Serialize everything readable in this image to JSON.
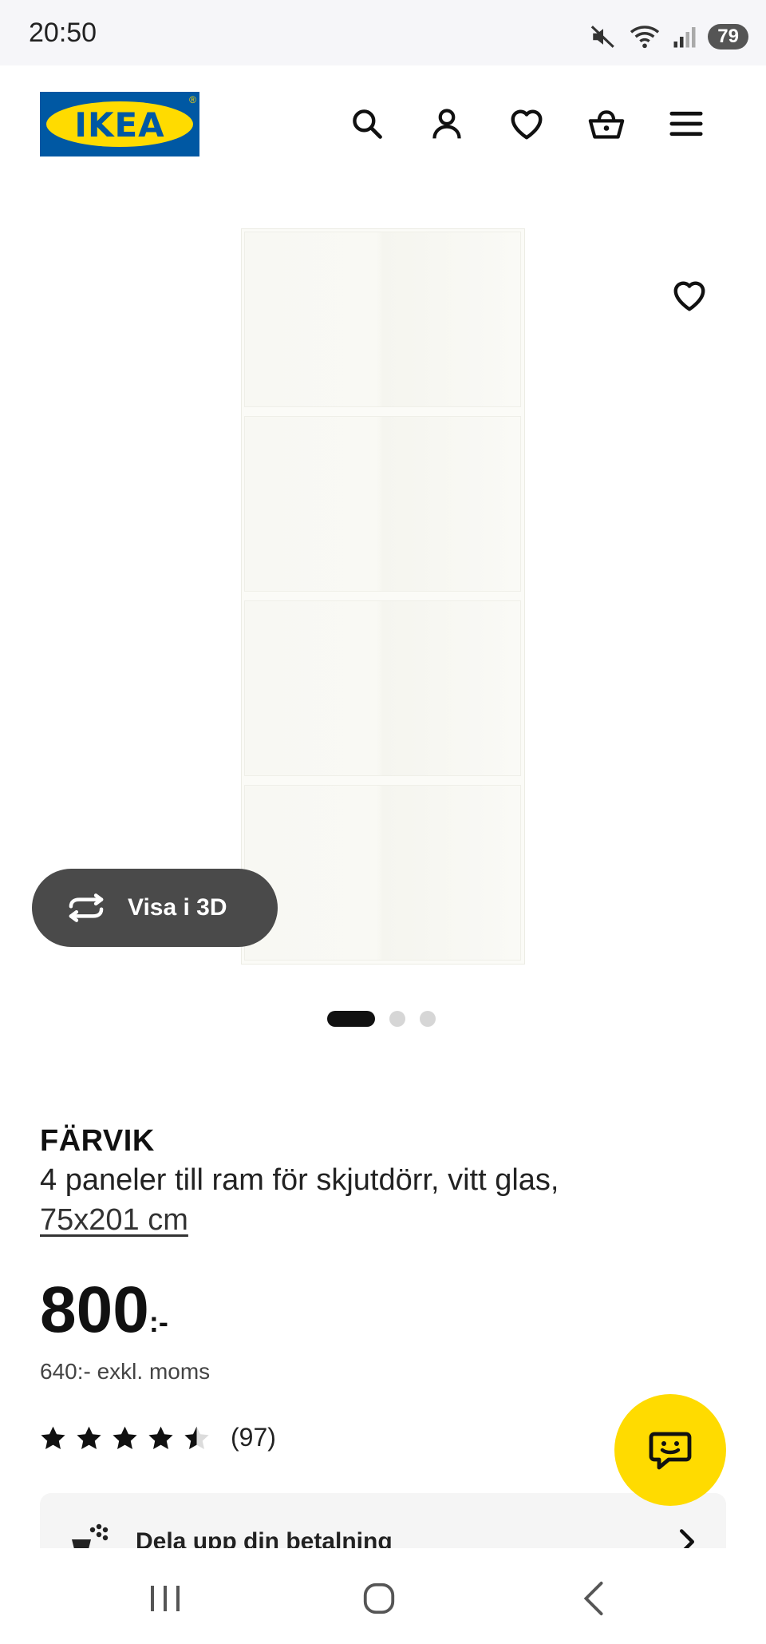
{
  "status_bar": {
    "time": "20:50",
    "battery": "79",
    "icons": [
      "mute-icon",
      "wifi-icon",
      "signal-icon"
    ]
  },
  "header": {
    "logo_text": "IKEA",
    "icons": [
      "search-icon",
      "account-icon",
      "heart-icon",
      "basket-icon",
      "menu-icon"
    ],
    "brand_colors": {
      "blue": "#0058a3",
      "yellow": "#ffdb00"
    }
  },
  "gallery": {
    "view_3d_label": "Visa i 3D",
    "current_slide": 1,
    "slide_count": 3
  },
  "product": {
    "name": "FÄRVIK",
    "description": "4 paneler till ram för skjutdörr, vitt glas,",
    "measurement": "75x201 cm",
    "price": "800",
    "price_suffix": ":-",
    "price_excl_vat": "640:- exkl. moms",
    "rating": 4.5,
    "review_count": "(97)"
  },
  "payment": {
    "label": "Dela upp din betalning"
  },
  "chat": {
    "icon": "chat-icon",
    "color": "#ffdb00"
  },
  "navbar": {
    "icons": [
      "recents-icon",
      "home-icon",
      "back-icon"
    ]
  }
}
